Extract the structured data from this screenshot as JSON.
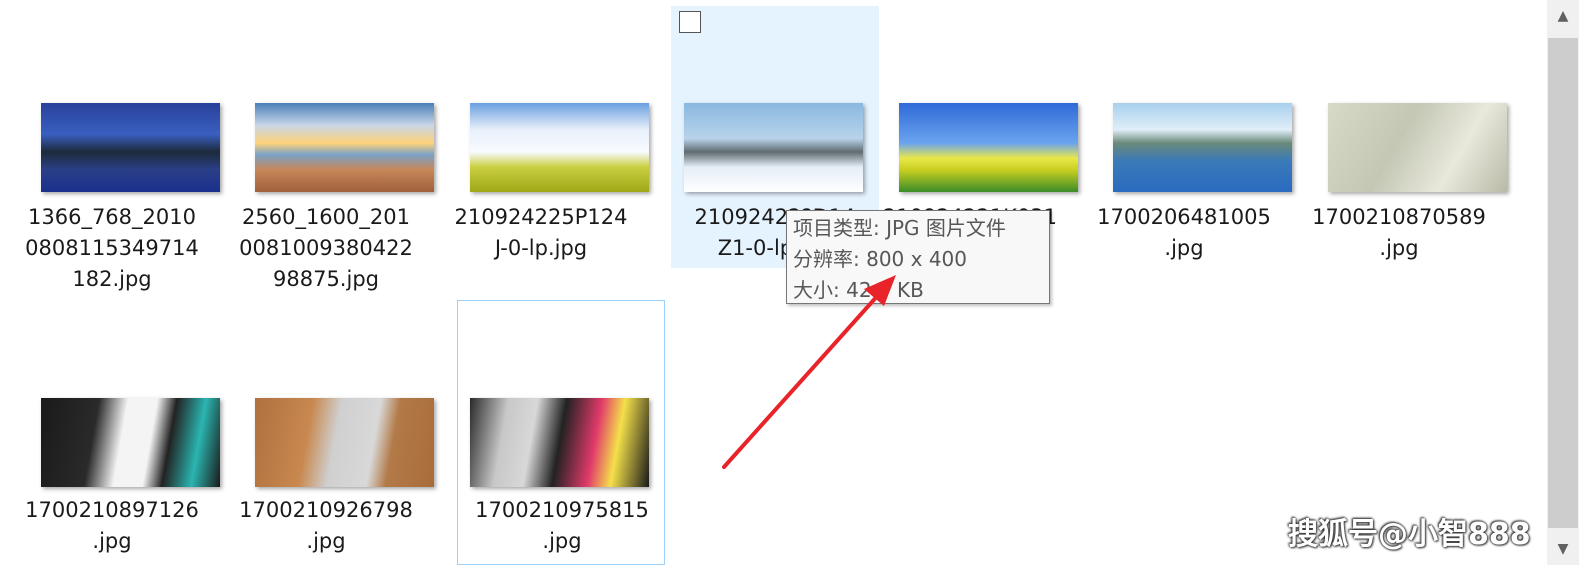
{
  "files": [
    {
      "name": "1366_768_20100808115349714182.jpg"
    },
    {
      "name": "2560_1600_2010081009380422 98875.jpg"
    },
    {
      "name": "210924225P124J-0-lp.jpg"
    },
    {
      "name": "210924221D14Z1-0-lp.jpg"
    },
    {
      "name": "210924221K031"
    },
    {
      "name": "1700206481005.jpg"
    },
    {
      "name": "1700210870589.jpg"
    },
    {
      "name": "1700210897126.jpg"
    },
    {
      "name": "1700210926798.jpg"
    },
    {
      "name": "1700210975815.jpg"
    }
  ],
  "display_names": [
    "1366_768_2010\n0808115349714\n182.jpg",
    "2560_1600_201\n0081009380422\n98875.jpg",
    "210924225P124\nJ-0-lp.jpg",
    "21092422?D14\nZ1-0-lp.jpg",
    "210924221K031",
    "1700206481005\n.jpg",
    "1700210870589\n.jpg",
    "1700210897126\n.jpg",
    "1700210926798\n.jpg",
    "1700210975815\n.jpg"
  ],
  "tooltip": {
    "type_line": "项目类型: JPG 图片文件",
    "resolution_line": "分辨率: 800 x 400",
    "size_line": "大小: 42.7 KB"
  },
  "annotation": {
    "arrow_color": "#e8232a"
  },
  "watermark": "搜狐号@小智888",
  "scrollbar": {
    "up_icon": "▲",
    "down_icon": "▼"
  }
}
